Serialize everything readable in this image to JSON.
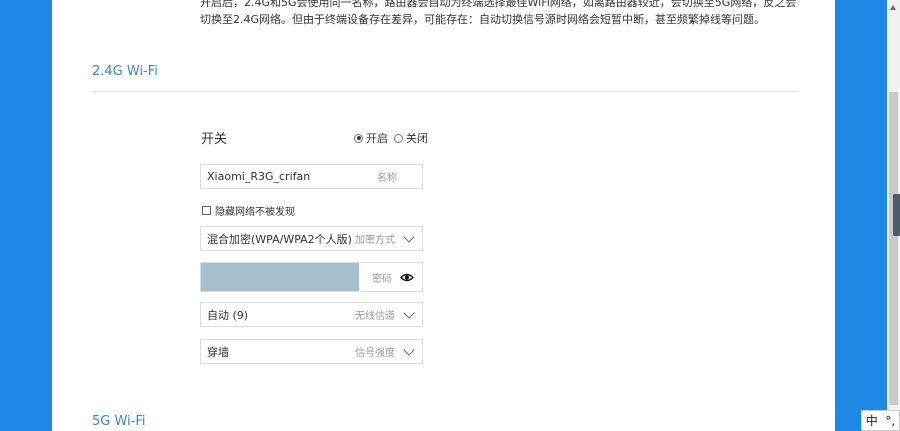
{
  "intro_text": "开启后，2.4G和5G会使用同一名称，路由器会自动为终端选择最佳WiFi网络，如离路由器较近，会切换至5G网络，反之会切换至2.4G网络。但由于终端设备存在差异，可能存在：自动切换信号源时网络会短暂中断，甚至频繁掉线等问题。",
  "section_24g": {
    "title": "2.4G Wi-Fi",
    "switch_label": "开关",
    "on_label": "开启",
    "off_label": "关闭",
    "ssid": {
      "value": "Xiaomi_R3G_crifan",
      "hint": "名称"
    },
    "hide_network_label": "隐藏网络不被发现",
    "encryption": {
      "value": "混合加密(WPA/WPA2个人版)",
      "hint": "加密方式"
    },
    "password": {
      "hint": "密码"
    },
    "channel": {
      "value": "自动 (9)",
      "hint": "无线信道"
    },
    "signal": {
      "value": "穿墙",
      "hint": "信号强度"
    }
  },
  "section_5g": {
    "title": "5G Wi-Fi"
  },
  "ime": {
    "lang": "中",
    "punct": "°,"
  }
}
